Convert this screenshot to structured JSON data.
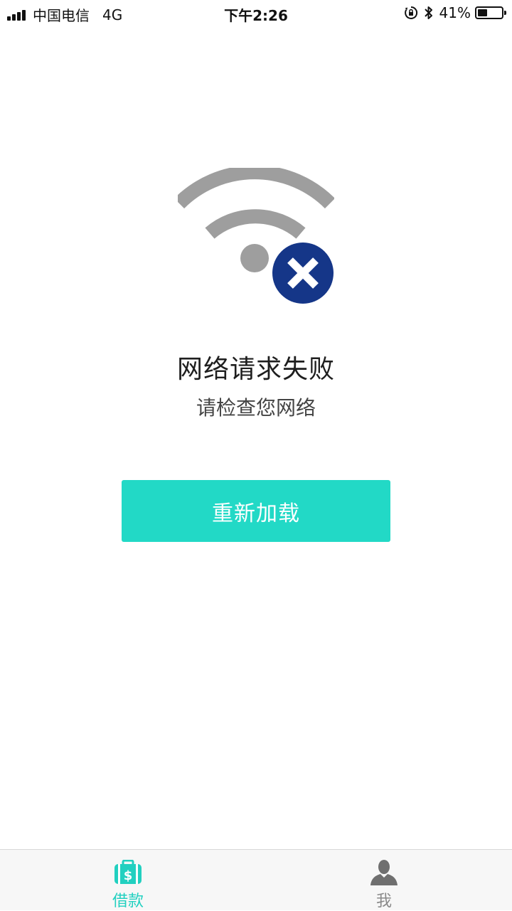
{
  "status_bar": {
    "carrier": "中国电信",
    "network": "4G",
    "time": "下午2:26",
    "battery_percent": "41%",
    "battery_level": 0.41,
    "icons": [
      "signal-icon",
      "orientation-lock-icon",
      "bluetooth-icon",
      "battery-icon"
    ]
  },
  "error": {
    "icon": "wifi-error-icon",
    "title": "网络请求失败",
    "subtitle": "请检查您网络"
  },
  "reload_button": {
    "label": "重新加载"
  },
  "tab_bar": {
    "tabs": [
      {
        "label": "借款",
        "icon": "loan-wallet-icon",
        "active": true
      },
      {
        "label": "我",
        "icon": "profile-icon",
        "active": false
      }
    ]
  },
  "colors": {
    "accent": "#22d9c6",
    "tab_active": "#22d0c0",
    "tab_inactive": "#8a8a8a",
    "wifi_gray": "#9e9e9e",
    "error_badge": "#153688"
  }
}
